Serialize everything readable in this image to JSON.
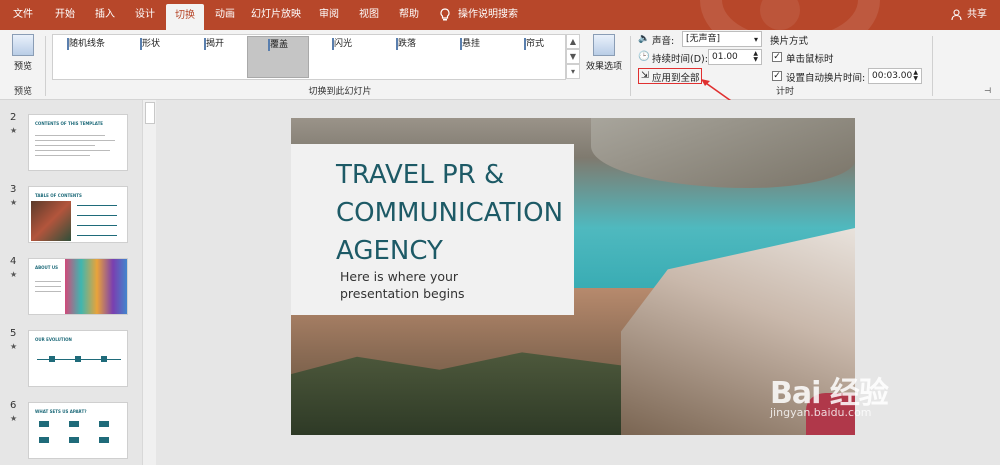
{
  "tabs": [
    {
      "label": "文件"
    },
    {
      "label": "开始"
    },
    {
      "label": "插入"
    },
    {
      "label": "设计"
    },
    {
      "label": "切换"
    },
    {
      "label": "动画"
    },
    {
      "label": "幻灯片放映"
    },
    {
      "label": "审阅"
    },
    {
      "label": "视图"
    },
    {
      "label": "帮助"
    }
  ],
  "tell_me": "操作说明搜索",
  "share": "共享",
  "ribbon": {
    "preview_button": "预览",
    "preview_group": "预览",
    "transitions": [
      {
        "label": "随机线条"
      },
      {
        "label": "形状"
      },
      {
        "label": "揭开"
      },
      {
        "label": "覆盖"
      },
      {
        "label": "闪光"
      },
      {
        "label": "跌落"
      },
      {
        "label": "悬挂"
      },
      {
        "label": "帘式"
      }
    ],
    "selected_transition": "覆盖",
    "effect_options": "效果选项",
    "transition_group": "切换到此幻灯片",
    "sound_label": "声音:",
    "sound_value": "[无声音]",
    "duration_label": "持续时间(D):",
    "duration_value": "01.00",
    "apply_all": "应用到全部",
    "advance_title": "换片方式",
    "on_click": "单击鼠标时",
    "after_time": "设置自动换片时间:",
    "after_value": "00:03.00",
    "timing_group": "计时"
  },
  "slides": [
    {
      "num": "2",
      "title": "CONTENTS OF THIS TEMPLATE"
    },
    {
      "num": "3",
      "title": "TABLE OF CONTENTS"
    },
    {
      "num": "4",
      "title": "ABOUT US"
    },
    {
      "num": "5",
      "title": "OUR EVOLUTION"
    },
    {
      "num": "6",
      "title": "WHAT SETS US APART?"
    }
  ],
  "main_slide": {
    "title_line1": "TRAVEL PR &",
    "title_line2": "COMMUNICATION",
    "title_line3": "AGENCY",
    "sub_line1": "Here is where your",
    "sub_line2": "presentation begins"
  },
  "watermark": {
    "main": "Bai 经验",
    "sub": "jingyan.baidu.com"
  },
  "colors": {
    "accent": "#b7472a",
    "slide_title": "#1d5a66",
    "highlight": "#e03030"
  }
}
